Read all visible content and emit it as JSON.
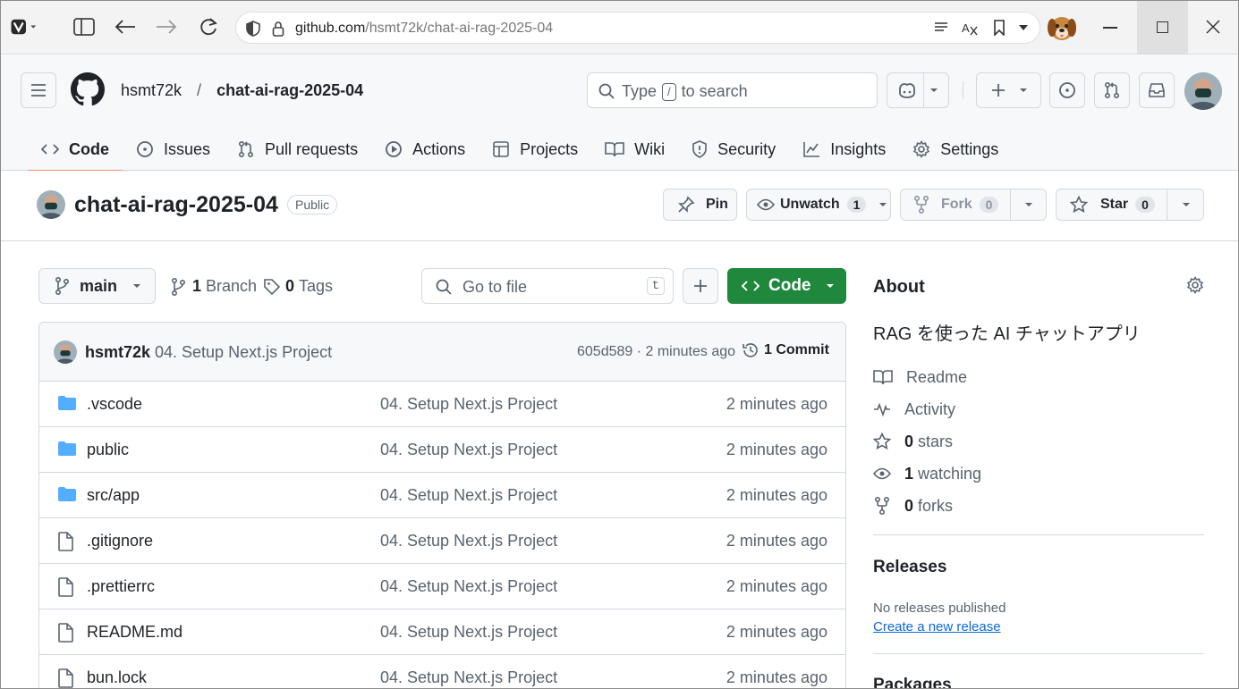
{
  "browser": {
    "url_host": "github.com",
    "url_path": "/hsmt72k/chat-ai-rag-2025-04"
  },
  "header": {
    "owner": "hsmt72k",
    "separator": "/",
    "repo": "chat-ai-rag-2025-04",
    "search_prefix": "Type",
    "search_key": "/",
    "search_suffix": "to search"
  },
  "tabs": [
    {
      "label": "Code"
    },
    {
      "label": "Issues"
    },
    {
      "label": "Pull requests"
    },
    {
      "label": "Actions"
    },
    {
      "label": "Projects"
    },
    {
      "label": "Wiki"
    },
    {
      "label": "Security"
    },
    {
      "label": "Insights"
    },
    {
      "label": "Settings"
    }
  ],
  "repo": {
    "name": "chat-ai-rag-2025-04",
    "visibility": "Public",
    "pin": "Pin",
    "unwatch": "Unwatch",
    "watch_count": "1",
    "fork": "Fork",
    "fork_count": "0",
    "star": "Star",
    "star_count": "0"
  },
  "toolbar": {
    "branch": "main",
    "branch_count": "1",
    "branch_label": "Branch",
    "tag_count": "0",
    "tag_label": "Tags",
    "goto_placeholder": "Go to file",
    "goto_key": "t",
    "code_label": "Code"
  },
  "commit": {
    "author": "hsmt72k",
    "message": "04. Setup Next.js Project",
    "meta": "605d589 · 2 minutes ago",
    "count": "1 Commit"
  },
  "files": [
    {
      "type": "dir",
      "name": ".vscode",
      "message": "04. Setup Next.js Project",
      "time": "2 minutes ago"
    },
    {
      "type": "dir",
      "name": "public",
      "message": "04. Setup Next.js Project",
      "time": "2 minutes ago"
    },
    {
      "type": "dir",
      "name": "src/app",
      "message": "04. Setup Next.js Project",
      "time": "2 minutes ago"
    },
    {
      "type": "file",
      "name": ".gitignore",
      "message": "04. Setup Next.js Project",
      "time": "2 minutes ago"
    },
    {
      "type": "file",
      "name": ".prettierrc",
      "message": "04. Setup Next.js Project",
      "time": "2 minutes ago"
    },
    {
      "type": "file",
      "name": "README.md",
      "message": "04. Setup Next.js Project",
      "time": "2 minutes ago"
    },
    {
      "type": "file",
      "name": "bun.lock",
      "message": "04. Setup Next.js Project",
      "time": "2 minutes ago"
    }
  ],
  "about": {
    "title": "About",
    "description": "RAG を使った AI チャットアプリ",
    "readme": "Readme",
    "activity": "Activity",
    "stars_count": "0",
    "stars_label": "stars",
    "watching_count": "1",
    "watching_label": "watching",
    "forks_count": "0",
    "forks_label": "forks"
  },
  "releases": {
    "title": "Releases",
    "none": "No releases published",
    "create": "Create a new release"
  },
  "packages": {
    "title": "Packages"
  },
  "colors": {
    "accent_green": "#1f883d",
    "tab_underline": "#fd8c73",
    "folder_blue": "#54aeff",
    "link_blue": "#0969da"
  }
}
